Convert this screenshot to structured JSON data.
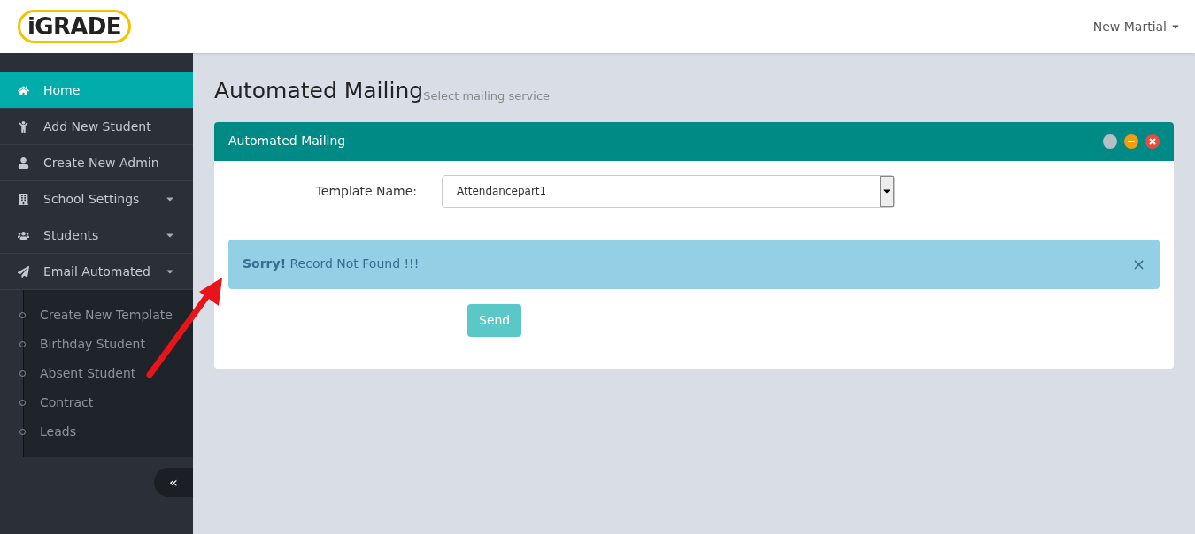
{
  "logo": {
    "text": "iGRADE"
  },
  "user_menu": {
    "label": "New Martial"
  },
  "sidebar": {
    "items": [
      {
        "label": "Home",
        "selected": true,
        "has_submenu": false
      },
      {
        "label": "Add New Student",
        "selected": false,
        "has_submenu": false
      },
      {
        "label": "Create New Admin",
        "selected": false,
        "has_submenu": false
      },
      {
        "label": "School Settings",
        "selected": false,
        "has_submenu": true
      },
      {
        "label": "Students",
        "selected": false,
        "has_submenu": true
      },
      {
        "label": "Email Automated",
        "selected": false,
        "has_submenu": true,
        "expanded": true,
        "children": [
          {
            "label": "Create New Template"
          },
          {
            "label": "Birthday Student"
          },
          {
            "label": "Absent Student"
          },
          {
            "label": "Contract"
          },
          {
            "label": "Leads"
          }
        ]
      }
    ],
    "collapse_label": "«"
  },
  "page": {
    "title": "Automated Mailing",
    "subtitle": "Select mailing service"
  },
  "panel": {
    "title": "Automated Mailing",
    "form": {
      "label": "Template Name:",
      "value": "Attendancepart1"
    },
    "alert": {
      "text": "**Sorry!** Record Not Found !!!",
      "close": "×"
    },
    "send_button": "Send"
  }
}
